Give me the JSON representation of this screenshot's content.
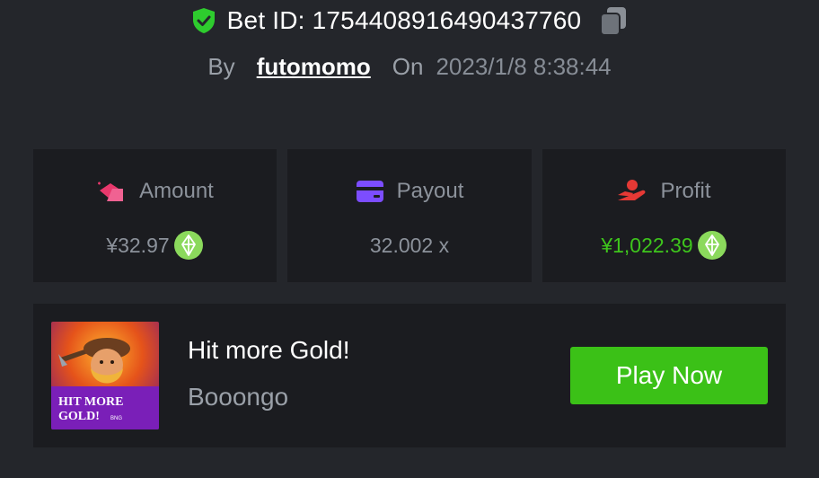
{
  "bet": {
    "id_text": "Bet ID: 17544089164904377​60",
    "verified_icon": "shield-check-icon",
    "copy_icon": "copy-icon"
  },
  "meta": {
    "by_label": "By",
    "username": "futomomo",
    "on_label": "On",
    "datetime": "2023/1/8 8:38:44"
  },
  "stats": {
    "amount": {
      "label": "Amount",
      "value": "¥32.97",
      "icon": "coins-icon",
      "currency_icon": "eos-coin-icon"
    },
    "payout": {
      "label": "Payout",
      "value": "32.002 x",
      "icon": "wallet-card-icon"
    },
    "profit": {
      "label": "Profit",
      "value": "¥1,022.39",
      "icon": "hand-profit-icon",
      "currency_icon": "eos-coin-icon"
    }
  },
  "game": {
    "title": "Hit more Gold!",
    "provider": "Booongo",
    "thumb_caption_1": "HIT MORE",
    "thumb_caption_2": "GOLD!",
    "thumb_brand": "BNG",
    "play_label": "Play Now"
  },
  "colors": {
    "background": "#24262b",
    "card": "#1b1c20",
    "accent_green": "#3bc117",
    "profit_green": "#3ec51c",
    "amount_pink": "#e8386c",
    "payout_purple": "#7c4dff",
    "profit_red": "#e53935"
  }
}
